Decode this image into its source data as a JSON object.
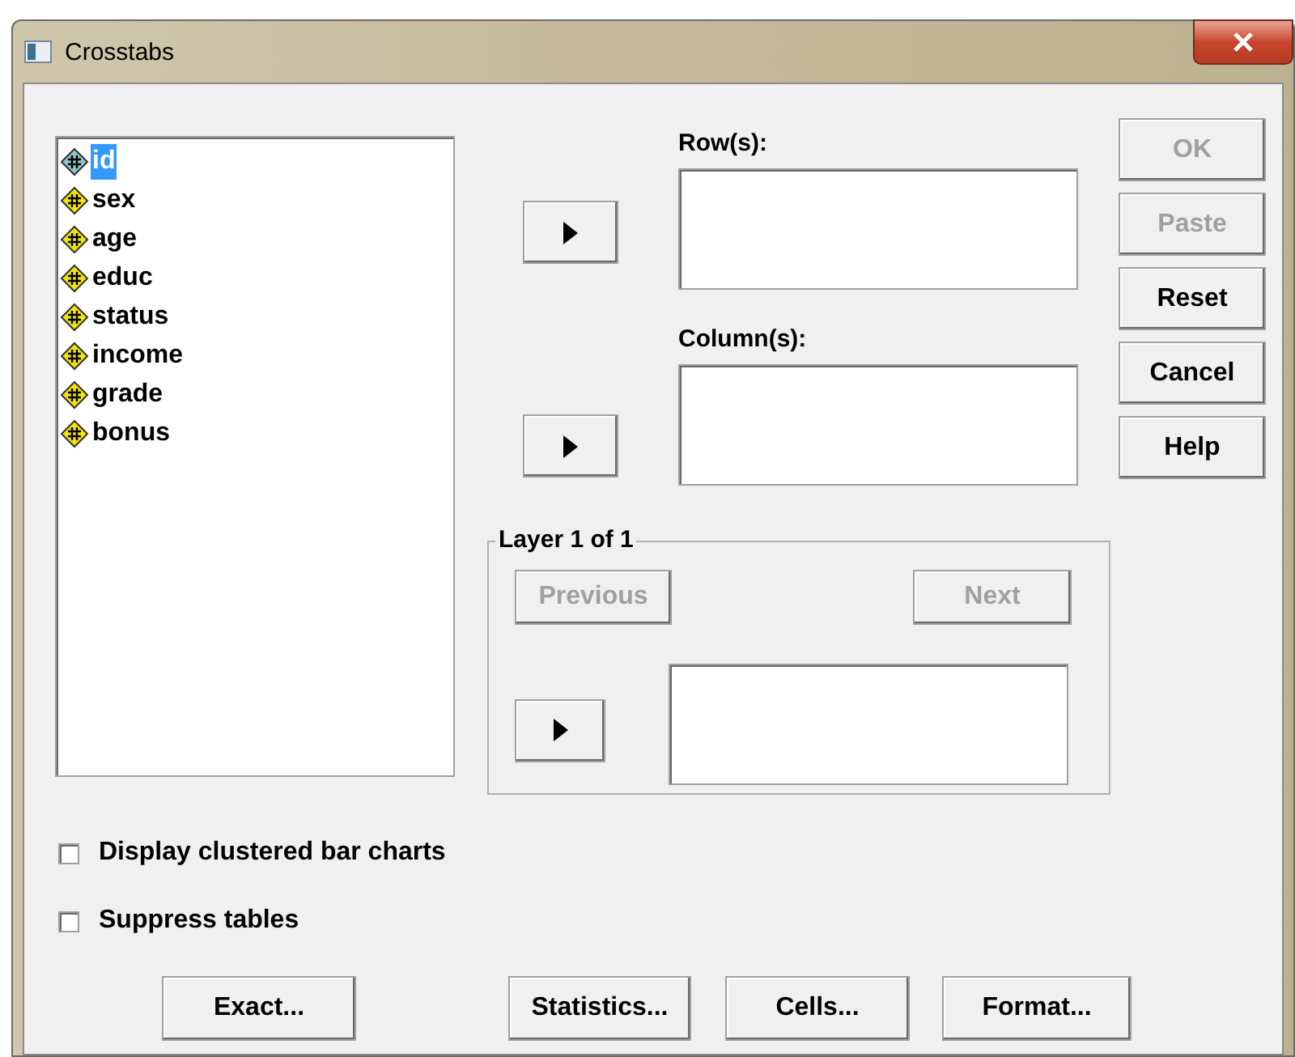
{
  "window": {
    "title": "Crosstabs"
  },
  "variables": [
    {
      "name": "id",
      "selected": true
    },
    {
      "name": "sex",
      "selected": false
    },
    {
      "name": "age",
      "selected": false
    },
    {
      "name": "educ",
      "selected": false
    },
    {
      "name": "status",
      "selected": false
    },
    {
      "name": "income",
      "selected": false
    },
    {
      "name": "grade",
      "selected": false
    },
    {
      "name": "bonus",
      "selected": false
    }
  ],
  "targets": [
    {
      "label": "Row(s):"
    },
    {
      "label": "Column(s):"
    }
  ],
  "side_buttons": [
    {
      "label": "OK",
      "disabled": true
    },
    {
      "label": "Paste",
      "disabled": true
    },
    {
      "label": "Reset",
      "disabled": false
    },
    {
      "label": "Cancel",
      "disabled": false
    },
    {
      "label": "Help",
      "disabled": false
    }
  ],
  "layer": {
    "title": "Layer 1 of 1",
    "previous": {
      "label": "Previous",
      "disabled": true
    },
    "next": {
      "label": "Next",
      "disabled": true
    }
  },
  "options": [
    {
      "label": "Display clustered bar charts",
      "checked": false
    },
    {
      "label": "Suppress tables",
      "checked": false
    }
  ],
  "bottom_buttons": [
    {
      "label": "Exact..."
    },
    {
      "label": "Statistics..."
    },
    {
      "label": "Cells..."
    },
    {
      "label": "Format..."
    }
  ]
}
